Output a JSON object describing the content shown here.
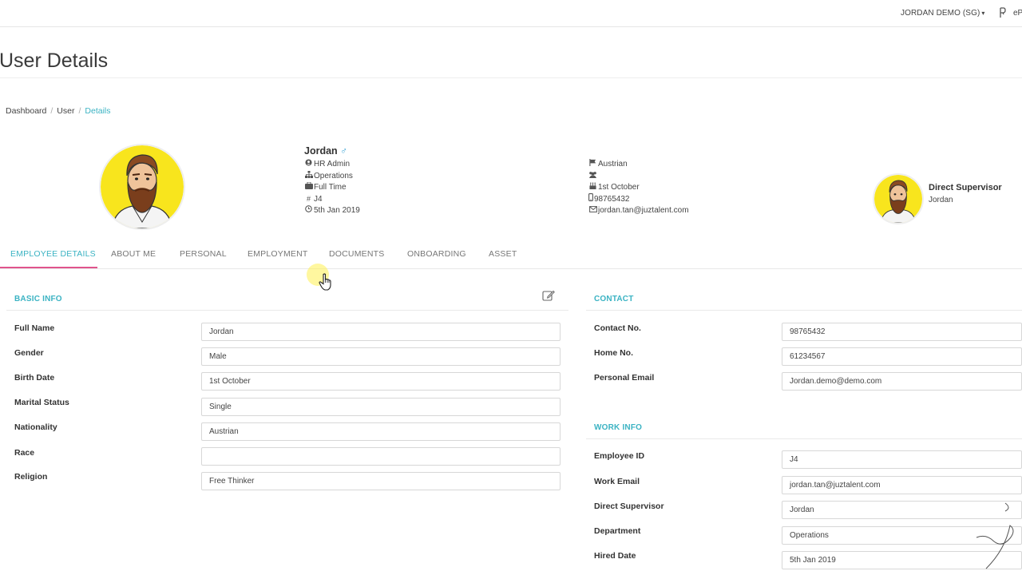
{
  "topbar": {
    "tenant_label": "JORDAN DEMO (SG)",
    "tenant_caret": "▾",
    "brand_text": "eP"
  },
  "page": {
    "title": "User Details"
  },
  "breadcrumb": {
    "items": [
      "Dashboard",
      "User",
      "Details"
    ],
    "separator": "/"
  },
  "profile": {
    "name": "Jordan",
    "gender_symbol": "♂",
    "role": "HR Admin",
    "department": "Operations",
    "employment_type": "Full Time",
    "employee_id": "J4",
    "hired_date": "5th Jan 2019",
    "nationality": "Austrian",
    "race": "",
    "birthday": "1st October",
    "phone": "98765432",
    "email": "jordan.tan@juztalent.com"
  },
  "supervisor": {
    "label": "Direct Supervisor",
    "name": "Jordan"
  },
  "tabs": [
    {
      "label": "EMPLOYEE DETAILS",
      "active": true
    },
    {
      "label": "ABOUT ME",
      "active": false
    },
    {
      "label": "PERSONAL",
      "active": false
    },
    {
      "label": "EMPLOYMENT",
      "active": false
    },
    {
      "label": "DOCUMENTS",
      "active": false
    },
    {
      "label": "ONBOARDING",
      "active": false
    },
    {
      "label": "ASSET",
      "active": false
    }
  ],
  "basic_info": {
    "title": "BASIC INFO",
    "fields": [
      {
        "label": "Full Name",
        "value": "Jordan"
      },
      {
        "label": "Gender",
        "value": "Male"
      },
      {
        "label": "Birth Date",
        "value": "1st October"
      },
      {
        "label": "Marital Status",
        "value": "Single"
      },
      {
        "label": "Nationality",
        "value": "Austrian"
      },
      {
        "label": "Race",
        "value": ""
      },
      {
        "label": "Religion",
        "value": "Free Thinker"
      }
    ]
  },
  "contact": {
    "title": "CONTACT",
    "fields": [
      {
        "label": "Contact No.",
        "value": "98765432"
      },
      {
        "label": "Home No.",
        "value": "61234567"
      },
      {
        "label": "Personal Email",
        "value": "Jordan.demo@demo.com"
      }
    ]
  },
  "work_info": {
    "title": "WORK INFO",
    "fields": [
      {
        "label": "Employee ID",
        "value": "J4"
      },
      {
        "label": "Work Email",
        "value": "jordan.tan@juztalent.com"
      },
      {
        "label": "Direct Supervisor",
        "value": "Jordan"
      },
      {
        "label": "Department",
        "value": "Operations"
      },
      {
        "label": "Hired Date",
        "value": "5th Jan 2019"
      }
    ]
  },
  "colors": {
    "accent": "#3bb3c3",
    "tab_underline": "#e0548c",
    "avatar_bg": "#f8e51d"
  },
  "icons": {
    "role": "user-circle-icon",
    "department": "sitemap-icon",
    "employment_type": "briefcase-icon",
    "employee_id": "hash-icon",
    "hired_date": "clock-icon",
    "nationality": "flag-icon",
    "race": "users-icon",
    "birthday": "birthday-cake-icon",
    "phone": "mobile-icon",
    "email": "envelope-icon",
    "edit": "edit-icon"
  }
}
